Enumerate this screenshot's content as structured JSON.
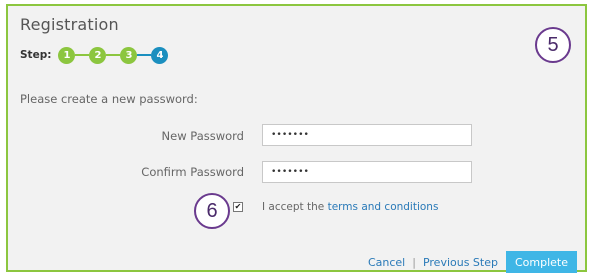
{
  "form": {
    "title": "Registration",
    "steps_label": "Step:",
    "steps": [
      "1",
      "2",
      "3",
      "4"
    ],
    "current_step": 4,
    "prompt": "Please create a new password:",
    "new_password": {
      "label": "New Password",
      "value": "•••••••"
    },
    "confirm_password": {
      "label": "Confirm Password",
      "value": "•••••••"
    },
    "accept": {
      "checked": true,
      "check_mark": "✔",
      "prefix": "I accept the",
      "link_text": "terms and conditions"
    },
    "footer": {
      "cancel": "Cancel",
      "separator": "|",
      "previous": "Previous Step",
      "complete": "Complete"
    }
  },
  "annotations": {
    "marker_5": "5",
    "marker_6": "6"
  },
  "colors": {
    "accent_green": "#8cc63f",
    "current_step_blue": "#1b8fbf",
    "complete_button": "#3fb6e6",
    "link_blue": "#2a7ab8",
    "annotation_purple": "#6a3a8e"
  }
}
